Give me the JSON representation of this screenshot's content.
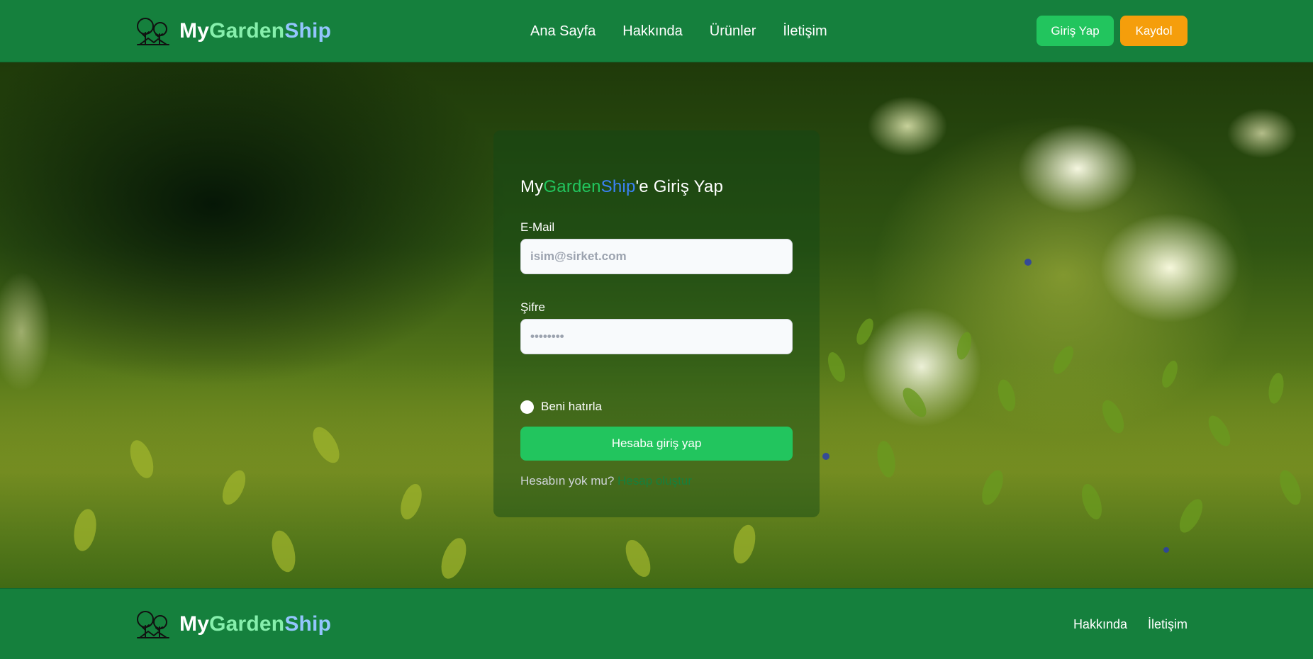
{
  "header": {
    "brand": {
      "part1": "My",
      "part2": "Garden",
      "part3": "Ship"
    },
    "nav": [
      "Ana Sayfa",
      "Hakkında",
      "Ürünler",
      "İletişim"
    ],
    "login_label": "Giriş Yap",
    "register_label": "Kaydol"
  },
  "login_card": {
    "title": {
      "part1": "My",
      "part2": "Garden",
      "part3": "Ship",
      "suffix": "'e Giriş Yap"
    },
    "email_label": "E-Mail",
    "email_placeholder": "isim@sirket.com",
    "password_label": "Şifre",
    "password_placeholder": "••••••••",
    "remember_label": "Beni hatırla",
    "submit_label": "Hesaba giriş yap",
    "signup_question": "Hesabın yok mu?",
    "signup_link": "Hesap oluştur"
  },
  "footer": {
    "brand": {
      "part1": "My",
      "part2": "Garden",
      "part3": "Ship"
    },
    "links": [
      "Hakkında",
      "İletişim"
    ]
  },
  "colors": {
    "header_bg": "#15803d",
    "brand_green": "#86efac",
    "brand_blue": "#93c5fd",
    "title_green": "#22c55e",
    "title_blue": "#3b82f6",
    "login_button": "#22c55e",
    "register_button": "#f59e0b"
  },
  "icons": {
    "logo": "two-trees-icon"
  }
}
